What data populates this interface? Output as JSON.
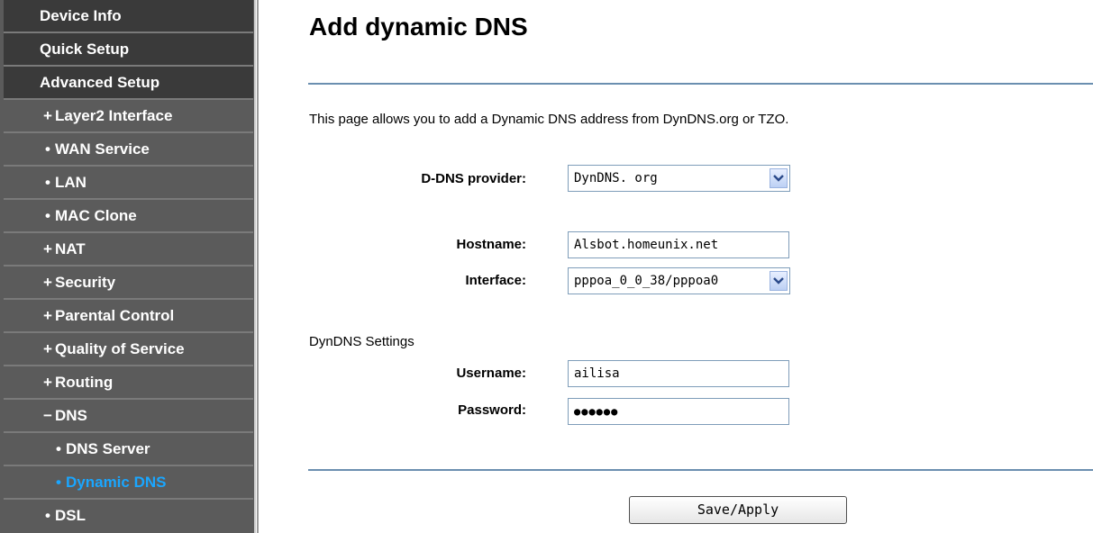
{
  "sidebar": {
    "items": [
      {
        "label": "Device Info",
        "marker": ""
      },
      {
        "label": "Quick Setup",
        "marker": ""
      },
      {
        "label": "Advanced Setup",
        "marker": ""
      },
      {
        "label": "Layer2 Interface",
        "marker": "+"
      },
      {
        "label": "WAN Service",
        "marker": "•"
      },
      {
        "label": "LAN",
        "marker": "•"
      },
      {
        "label": "MAC Clone",
        "marker": "•"
      },
      {
        "label": "NAT",
        "marker": "+"
      },
      {
        "label": "Security",
        "marker": "+"
      },
      {
        "label": "Parental Control",
        "marker": "+"
      },
      {
        "label": "Quality of Service",
        "marker": "+"
      },
      {
        "label": "Routing",
        "marker": "+"
      },
      {
        "label": "DNS",
        "marker": "−"
      },
      {
        "label": "DNS Server",
        "marker": "•"
      },
      {
        "label": "Dynamic DNS",
        "marker": "•"
      },
      {
        "label": "DSL",
        "marker": "•"
      }
    ],
    "active_color": "#1aa6ff"
  },
  "main": {
    "title": "Add dynamic DNS",
    "description": "This page allows you to add a Dynamic DNS address from DynDNS.org or TZO.",
    "provider": {
      "label": "D-DNS provider:",
      "value": "DynDNS. org"
    },
    "hostname": {
      "label": "Hostname:",
      "value": "Alsbot.homeunix.net"
    },
    "interface": {
      "label": "Interface:",
      "value": "pppoa_0_0_38/pppoa0"
    },
    "settings_heading": "DynDNS Settings",
    "username": {
      "label": "Username:",
      "value": "ailisa"
    },
    "password": {
      "label": "Password:",
      "value": "●●●●●●"
    },
    "save_label": "Save/Apply"
  }
}
